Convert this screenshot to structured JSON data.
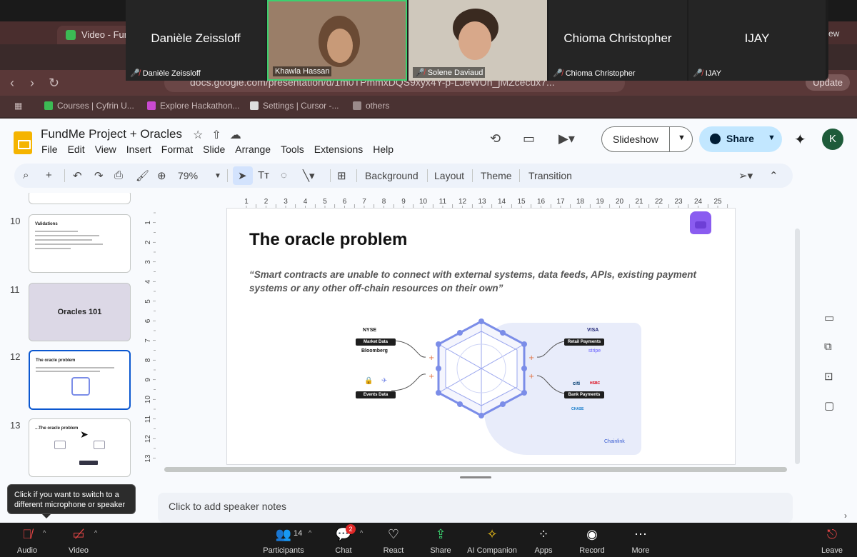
{
  "browser": {
    "tab_title": "Video - Fun",
    "url": "docs.google.com/presentation/d/1m0TPmmxDQS9xyx4Y-p-LJeWUn_jMZcecux7...",
    "update_label": "Update",
    "bookmarks": [
      "Courses | Cyfrin U...",
      "Explore Hackathon...",
      "Settings | Cursor -...",
      "others"
    ]
  },
  "meeting": {
    "participants": [
      {
        "name": "Danièle Zeissloff",
        "label": "Danièle Zeissloff",
        "video": false
      },
      {
        "name": "Khawla Hassan",
        "label": "Khawla Hassan",
        "video": true
      },
      {
        "name": "Solene Daviaud",
        "label": "Solene Daviaud",
        "video": true
      },
      {
        "name": "Chioma Christopher",
        "label": "Chioma Christopher",
        "video": false
      },
      {
        "name": "IJAY",
        "label": "IJAY",
        "video": false
      }
    ],
    "view_label": "ew",
    "toolbar": {
      "audio": "Audio",
      "video": "Video",
      "participants": "Participants",
      "participants_count": "14",
      "chat": "Chat",
      "chat_badge": "2",
      "react": "React",
      "share": "Share",
      "ai_companion": "AI Companion",
      "apps": "Apps",
      "record": "Record",
      "more": "More",
      "leave": "Leave"
    },
    "tooltip": "Click if you want to switch to a different microphone or speaker"
  },
  "slides_app": {
    "doc_title": "FundMe Project + Oracles",
    "menu": [
      "File",
      "Edit",
      "View",
      "Insert",
      "Format",
      "Slide",
      "Arrange",
      "Tools",
      "Extensions",
      "Help"
    ],
    "slideshow_label": "Slideshow",
    "share_label": "Share",
    "avatar_initial": "K",
    "zoom": "79%",
    "toolbar_text": [
      "Background",
      "Layout",
      "Theme",
      "Transition"
    ],
    "speaker_notes_placeholder": "Click to add speaker notes",
    "ruler_top": [
      "1",
      "2",
      "3",
      "4",
      "5",
      "6",
      "7",
      "8",
      "9",
      "10",
      "11",
      "12",
      "13",
      "14",
      "15",
      "16",
      "17",
      "18",
      "19",
      "20",
      "21",
      "22",
      "23",
      "24",
      "25"
    ],
    "ruler_left": [
      "1",
      "2",
      "3",
      "4",
      "5",
      "6",
      "7",
      "8",
      "9",
      "10",
      "11",
      "12",
      "13"
    ]
  },
  "filmstrip": [
    {
      "number": "10",
      "title": "Validations",
      "kind": "text"
    },
    {
      "number": "11",
      "title": "Oracles 101",
      "kind": "section"
    },
    {
      "number": "12",
      "title": "The oracle problem",
      "kind": "diagram",
      "selected": true
    },
    {
      "number": "13",
      "title": "...The oracle problem",
      "kind": "diagram"
    }
  ],
  "slide": {
    "title": "The oracle problem",
    "quote": "“Smart contracts are unable to connect with external systems, data feeds, APIs, existing payment systems or any other off-chain resources on their own”",
    "diagram": {
      "left_tags": [
        "Market Data",
        "Events Data"
      ],
      "left_labels": [
        "NYSE",
        "Bloomberg"
      ],
      "right_tags": [
        "Retail Payments",
        "Bank Payments"
      ],
      "right_labels": [
        "VISA",
        "stripe",
        "citi",
        "HSBC",
        "CHASE"
      ],
      "brand": "Chainlink"
    }
  },
  "colors": {
    "share_bg": "#c2e7ff",
    "selected_border": "#0b57d0",
    "active_speaker": "#3bd16f",
    "muted_red": "#e54545",
    "hexagon": "#7b8de8"
  }
}
